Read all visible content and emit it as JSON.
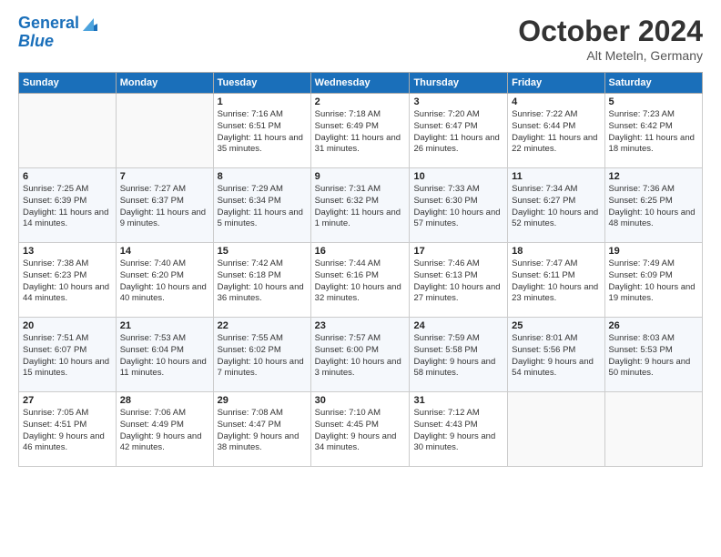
{
  "logo": {
    "line1": "General",
    "line2": "Blue"
  },
  "title": "October 2024",
  "subtitle": "Alt Meteln, Germany",
  "weekdays": [
    "Sunday",
    "Monday",
    "Tuesday",
    "Wednesday",
    "Thursday",
    "Friday",
    "Saturday"
  ],
  "weeks": [
    [
      {
        "day": "",
        "sunrise": "",
        "sunset": "",
        "daylight": ""
      },
      {
        "day": "",
        "sunrise": "",
        "sunset": "",
        "daylight": ""
      },
      {
        "day": "1",
        "sunrise": "Sunrise: 7:16 AM",
        "sunset": "Sunset: 6:51 PM",
        "daylight": "Daylight: 11 hours and 35 minutes."
      },
      {
        "day": "2",
        "sunrise": "Sunrise: 7:18 AM",
        "sunset": "Sunset: 6:49 PM",
        "daylight": "Daylight: 11 hours and 31 minutes."
      },
      {
        "day": "3",
        "sunrise": "Sunrise: 7:20 AM",
        "sunset": "Sunset: 6:47 PM",
        "daylight": "Daylight: 11 hours and 26 minutes."
      },
      {
        "day": "4",
        "sunrise": "Sunrise: 7:22 AM",
        "sunset": "Sunset: 6:44 PM",
        "daylight": "Daylight: 11 hours and 22 minutes."
      },
      {
        "day": "5",
        "sunrise": "Sunrise: 7:23 AM",
        "sunset": "Sunset: 6:42 PM",
        "daylight": "Daylight: 11 hours and 18 minutes."
      }
    ],
    [
      {
        "day": "6",
        "sunrise": "Sunrise: 7:25 AM",
        "sunset": "Sunset: 6:39 PM",
        "daylight": "Daylight: 11 hours and 14 minutes."
      },
      {
        "day": "7",
        "sunrise": "Sunrise: 7:27 AM",
        "sunset": "Sunset: 6:37 PM",
        "daylight": "Daylight: 11 hours and 9 minutes."
      },
      {
        "day": "8",
        "sunrise": "Sunrise: 7:29 AM",
        "sunset": "Sunset: 6:34 PM",
        "daylight": "Daylight: 11 hours and 5 minutes."
      },
      {
        "day": "9",
        "sunrise": "Sunrise: 7:31 AM",
        "sunset": "Sunset: 6:32 PM",
        "daylight": "Daylight: 11 hours and 1 minute."
      },
      {
        "day": "10",
        "sunrise": "Sunrise: 7:33 AM",
        "sunset": "Sunset: 6:30 PM",
        "daylight": "Daylight: 10 hours and 57 minutes."
      },
      {
        "day": "11",
        "sunrise": "Sunrise: 7:34 AM",
        "sunset": "Sunset: 6:27 PM",
        "daylight": "Daylight: 10 hours and 52 minutes."
      },
      {
        "day": "12",
        "sunrise": "Sunrise: 7:36 AM",
        "sunset": "Sunset: 6:25 PM",
        "daylight": "Daylight: 10 hours and 48 minutes."
      }
    ],
    [
      {
        "day": "13",
        "sunrise": "Sunrise: 7:38 AM",
        "sunset": "Sunset: 6:23 PM",
        "daylight": "Daylight: 10 hours and 44 minutes."
      },
      {
        "day": "14",
        "sunrise": "Sunrise: 7:40 AM",
        "sunset": "Sunset: 6:20 PM",
        "daylight": "Daylight: 10 hours and 40 minutes."
      },
      {
        "day": "15",
        "sunrise": "Sunrise: 7:42 AM",
        "sunset": "Sunset: 6:18 PM",
        "daylight": "Daylight: 10 hours and 36 minutes."
      },
      {
        "day": "16",
        "sunrise": "Sunrise: 7:44 AM",
        "sunset": "Sunset: 6:16 PM",
        "daylight": "Daylight: 10 hours and 32 minutes."
      },
      {
        "day": "17",
        "sunrise": "Sunrise: 7:46 AM",
        "sunset": "Sunset: 6:13 PM",
        "daylight": "Daylight: 10 hours and 27 minutes."
      },
      {
        "day": "18",
        "sunrise": "Sunrise: 7:47 AM",
        "sunset": "Sunset: 6:11 PM",
        "daylight": "Daylight: 10 hours and 23 minutes."
      },
      {
        "day": "19",
        "sunrise": "Sunrise: 7:49 AM",
        "sunset": "Sunset: 6:09 PM",
        "daylight": "Daylight: 10 hours and 19 minutes."
      }
    ],
    [
      {
        "day": "20",
        "sunrise": "Sunrise: 7:51 AM",
        "sunset": "Sunset: 6:07 PM",
        "daylight": "Daylight: 10 hours and 15 minutes."
      },
      {
        "day": "21",
        "sunrise": "Sunrise: 7:53 AM",
        "sunset": "Sunset: 6:04 PM",
        "daylight": "Daylight: 10 hours and 11 minutes."
      },
      {
        "day": "22",
        "sunrise": "Sunrise: 7:55 AM",
        "sunset": "Sunset: 6:02 PM",
        "daylight": "Daylight: 10 hours and 7 minutes."
      },
      {
        "day": "23",
        "sunrise": "Sunrise: 7:57 AM",
        "sunset": "Sunset: 6:00 PM",
        "daylight": "Daylight: 10 hours and 3 minutes."
      },
      {
        "day": "24",
        "sunrise": "Sunrise: 7:59 AM",
        "sunset": "Sunset: 5:58 PM",
        "daylight": "Daylight: 9 hours and 58 minutes."
      },
      {
        "day": "25",
        "sunrise": "Sunrise: 8:01 AM",
        "sunset": "Sunset: 5:56 PM",
        "daylight": "Daylight: 9 hours and 54 minutes."
      },
      {
        "day": "26",
        "sunrise": "Sunrise: 8:03 AM",
        "sunset": "Sunset: 5:53 PM",
        "daylight": "Daylight: 9 hours and 50 minutes."
      }
    ],
    [
      {
        "day": "27",
        "sunrise": "Sunrise: 7:05 AM",
        "sunset": "Sunset: 4:51 PM",
        "daylight": "Daylight: 9 hours and 46 minutes."
      },
      {
        "day": "28",
        "sunrise": "Sunrise: 7:06 AM",
        "sunset": "Sunset: 4:49 PM",
        "daylight": "Daylight: 9 hours and 42 minutes."
      },
      {
        "day": "29",
        "sunrise": "Sunrise: 7:08 AM",
        "sunset": "Sunset: 4:47 PM",
        "daylight": "Daylight: 9 hours and 38 minutes."
      },
      {
        "day": "30",
        "sunrise": "Sunrise: 7:10 AM",
        "sunset": "Sunset: 4:45 PM",
        "daylight": "Daylight: 9 hours and 34 minutes."
      },
      {
        "day": "31",
        "sunrise": "Sunrise: 7:12 AM",
        "sunset": "Sunset: 4:43 PM",
        "daylight": "Daylight: 9 hours and 30 minutes."
      },
      {
        "day": "",
        "sunrise": "",
        "sunset": "",
        "daylight": ""
      },
      {
        "day": "",
        "sunrise": "",
        "sunset": "",
        "daylight": ""
      }
    ]
  ]
}
